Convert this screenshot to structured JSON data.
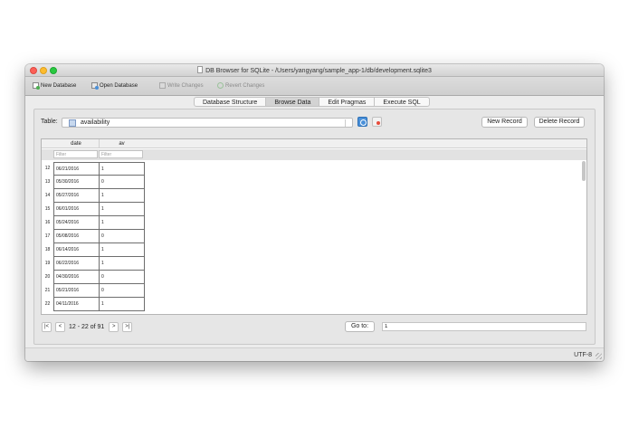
{
  "window": {
    "title": "DB Browser for SQLite - /Users/yangyang/sample_app-1/db/development.sqlite3"
  },
  "toolbar": {
    "new_database": "New Database",
    "open_database": "Open Database",
    "write_changes": "Write Changes",
    "revert_changes": "Revert Changes"
  },
  "tabs": [
    "Database Structure",
    "Browse Data",
    "Edit Pragmas",
    "Execute SQL"
  ],
  "active_tab": "Browse Data",
  "browse": {
    "table_label": "Table:",
    "table_name": "availability",
    "new_record": "New Record",
    "delete_record": "Delete Record"
  },
  "grid": {
    "columns": [
      "date",
      "av"
    ],
    "filter_placeholder": "Filter",
    "rows": [
      {
        "num": "12",
        "date": "06/21/2016",
        "av": "1"
      },
      {
        "num": "13",
        "date": "05/30/2016",
        "av": "0"
      },
      {
        "num": "14",
        "date": "05/27/2016",
        "av": "1"
      },
      {
        "num": "15",
        "date": "06/01/2016",
        "av": "1"
      },
      {
        "num": "16",
        "date": "05/24/2016",
        "av": "1"
      },
      {
        "num": "17",
        "date": "05/08/2016",
        "av": "0"
      },
      {
        "num": "18",
        "date": "06/14/2016",
        "av": "1"
      },
      {
        "num": "19",
        "date": "06/22/2016",
        "av": "1"
      },
      {
        "num": "20",
        "date": "04/30/2016",
        "av": "0"
      },
      {
        "num": "21",
        "date": "05/21/2016",
        "av": "0"
      },
      {
        "num": "22",
        "date": "04/11/2016",
        "av": "1"
      }
    ]
  },
  "navigation": {
    "first": "|<",
    "prev": "<",
    "range": "12 - 22 of 91",
    "next": ">",
    "last": ">|",
    "goto_label": "Go to:",
    "goto_value": "1"
  },
  "status": {
    "encoding": "UTF-8"
  }
}
